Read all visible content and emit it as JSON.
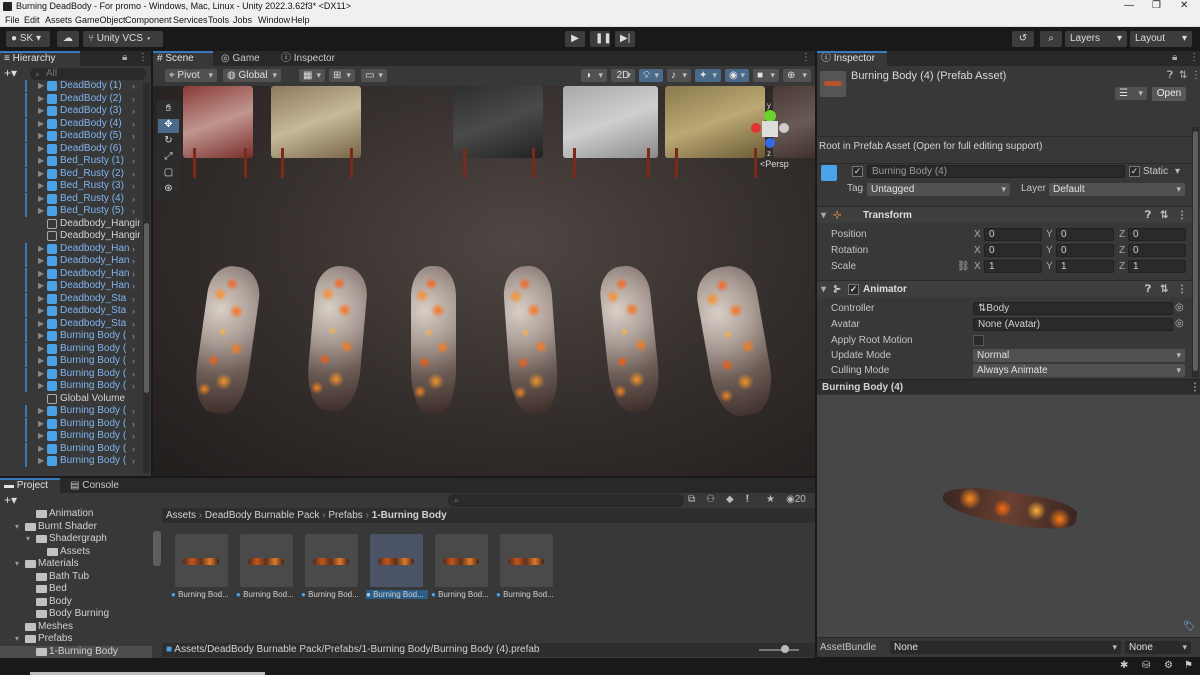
{
  "titlebar": {
    "title": "Burning DeadBody - For promo - Windows, Mac, Linux - Unity 2022.3.62f3* <DX11>",
    "minimize": "—",
    "maximize": "❐",
    "close": "✕"
  },
  "menu": [
    "File",
    "Edit",
    "Assets",
    "GameObject",
    "Component",
    "Services",
    "Tools",
    "Jobs",
    "Window",
    "Help"
  ],
  "toolbar": {
    "account": "SK",
    "vcs": "Unity VCS",
    "layers": "Layers",
    "layout": "Layout"
  },
  "hierarchy": {
    "tab": "Hierarchy",
    "search_placeholder": "All",
    "items": [
      {
        "label": "DeadBody (1)",
        "type": "prefab"
      },
      {
        "label": "DeadBody (2)",
        "type": "prefab"
      },
      {
        "label": "DeadBody (3)",
        "type": "prefab"
      },
      {
        "label": "DeadBody (4)",
        "type": "prefab"
      },
      {
        "label": "DeadBody (5)",
        "type": "prefab"
      },
      {
        "label": "DeadBody (6)",
        "type": "prefab"
      },
      {
        "label": "Bed_Rusty (1)",
        "type": "prefab"
      },
      {
        "label": "Bed_Rusty (2)",
        "type": "prefab"
      },
      {
        "label": "Bed_Rusty (3)",
        "type": "prefab"
      },
      {
        "label": "Bed_Rusty (4)",
        "type": "prefab"
      },
      {
        "label": "Bed_Rusty (5)",
        "type": "prefab"
      },
      {
        "label": "Deadbody_Hangin",
        "type": "object"
      },
      {
        "label": "Deadbody_Hangin",
        "type": "object"
      },
      {
        "label": "Deadbody_Han",
        "type": "prefab"
      },
      {
        "label": "Deadbody_Han",
        "type": "prefab"
      },
      {
        "label": "Deadbody_Han",
        "type": "prefab"
      },
      {
        "label": "Deadbody_Han",
        "type": "prefab"
      },
      {
        "label": "Deadbody_Sta",
        "type": "prefab"
      },
      {
        "label": "Deadbody_Sta",
        "type": "prefab"
      },
      {
        "label": "Deadbody_Sta",
        "type": "prefab"
      },
      {
        "label": "Burning Body (",
        "type": "prefab"
      },
      {
        "label": "Burning Body (",
        "type": "prefab"
      },
      {
        "label": "Burning Body (",
        "type": "prefab"
      },
      {
        "label": "Burning Body (",
        "type": "prefab"
      },
      {
        "label": "Burning Body (",
        "type": "prefab"
      },
      {
        "label": "Global Volume",
        "type": "object"
      },
      {
        "label": "Burning Body (",
        "type": "prefab"
      },
      {
        "label": "Burning Body (",
        "type": "prefab"
      },
      {
        "label": "Burning Body (",
        "type": "prefab"
      },
      {
        "label": "Burning Body (",
        "type": "prefab"
      },
      {
        "label": "Burning Body (",
        "type": "prefab"
      }
    ]
  },
  "scene": {
    "tabs": [
      "Scene",
      "Game",
      "Inspector"
    ],
    "pivot": "Pivot",
    "global": "Global",
    "mode2d": "2D",
    "persp": "Persp",
    "gizmo_y": "y",
    "gizmo_z": "z"
  },
  "inspector": {
    "tab": "Inspector",
    "asset_title": "Burning Body (4) (Prefab Asset)",
    "open_button": "Open",
    "root_note": "Root in Prefab Asset (Open for full editing support)",
    "object_name": "Burning Body (4)",
    "static_label": "Static",
    "tag_label": "Tag",
    "tag_value": "Untagged",
    "layer_label": "Layer",
    "layer_value": "Default",
    "transform": {
      "title": "Transform",
      "position_label": "Position",
      "rotation_label": "Rotation",
      "scale_label": "Scale",
      "position": {
        "x": "0",
        "y": "0",
        "z": "0"
      },
      "rotation": {
        "x": "0",
        "y": "0",
        "z": "0"
      },
      "scale": {
        "x": "1",
        "y": "1",
        "z": "1"
      }
    },
    "animator": {
      "title": "Animator",
      "controller_label": "Controller",
      "controller_value": "Body",
      "avatar_label": "Avatar",
      "avatar_value": "None (Avatar)",
      "apply_root_label": "Apply Root Motion",
      "update_label": "Update Mode",
      "update_value": "Normal",
      "culling_label": "Culling Mode",
      "culling_value": "Always Animate"
    },
    "preview_title": "Burning Body (4)",
    "assetbundle_label": "AssetBundle",
    "assetbundle_value": "None",
    "assetbundle_variant": "None"
  },
  "project": {
    "tabs": [
      "Project",
      "Console"
    ],
    "count": "20",
    "tree": [
      {
        "label": "Animation",
        "indent": 2,
        "arrow": ""
      },
      {
        "label": "Burnt Shader",
        "indent": 1,
        "arrow": "▾"
      },
      {
        "label": "Shadergraph",
        "indent": 2,
        "arrow": "▾"
      },
      {
        "label": "Assets",
        "indent": 3,
        "arrow": ""
      },
      {
        "label": "Materials",
        "indent": 1,
        "arrow": "▾"
      },
      {
        "label": "Bath Tub",
        "indent": 2,
        "arrow": ""
      },
      {
        "label": "Bed",
        "indent": 2,
        "arrow": ""
      },
      {
        "label": "Body",
        "indent": 2,
        "arrow": ""
      },
      {
        "label": "Body Burning",
        "indent": 2,
        "arrow": ""
      },
      {
        "label": "Meshes",
        "indent": 1,
        "arrow": ""
      },
      {
        "label": "Prefabs",
        "indent": 1,
        "arrow": "▾"
      },
      {
        "label": "1-Burning Body",
        "indent": 2,
        "arrow": ""
      }
    ],
    "breadcrumb": [
      "Assets",
      "DeadBody Burnable Pack",
      "Prefabs",
      "1-Burning Body"
    ],
    "assets": [
      "Burning Bod...",
      "Burning Bod...",
      "Burning Bod...",
      "Burning Bod...",
      "Burning Bod...",
      "Burning Bod..."
    ],
    "path": "Assets/DeadBody Burnable Pack/Prefabs/1-Burning Body/Burning Body (4).prefab"
  }
}
